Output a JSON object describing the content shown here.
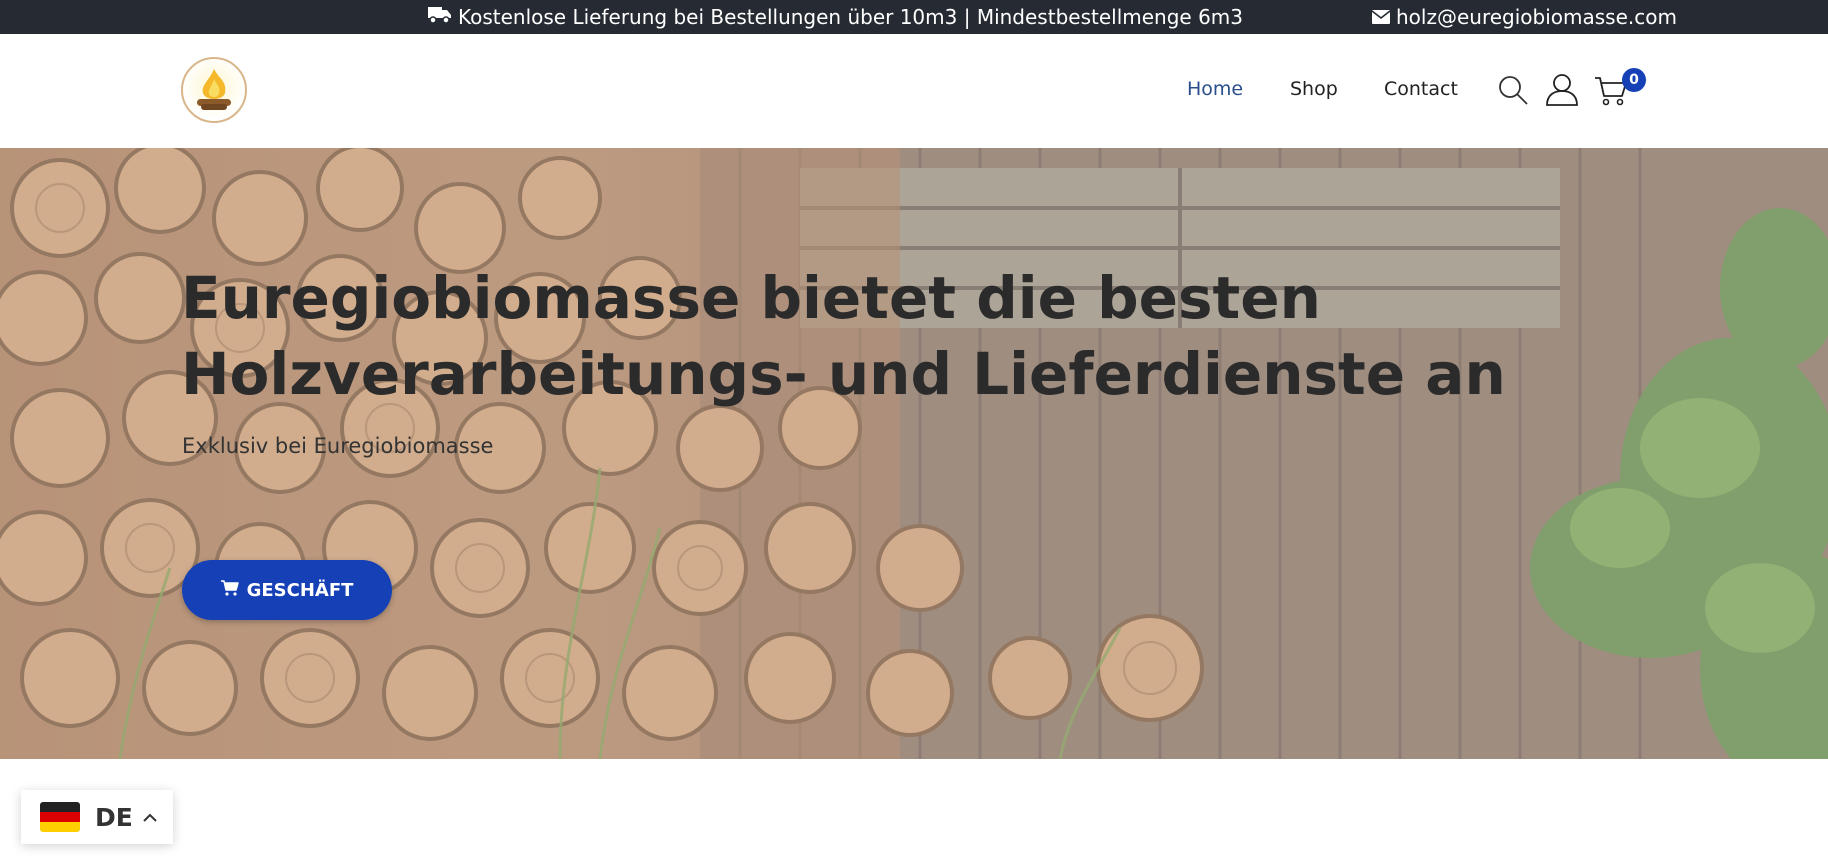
{
  "topbar": {
    "promo_icon": "truck-icon",
    "promo_text": "Kostenlose Lieferung bei Bestellungen über 10m3 | Mindestbestellmenge 6m3",
    "email_icon": "envelope-icon",
    "email": "holz@euregiobiomasse.com",
    "background": "#262b33"
  },
  "header": {
    "logo": "euregiobiomasse-logo",
    "nav": [
      {
        "label": "Home",
        "active": true
      },
      {
        "label": "Shop",
        "active": false
      },
      {
        "label": "Contact",
        "active": false
      }
    ],
    "icons": [
      "search-icon",
      "user-icon",
      "cart-icon"
    ],
    "cart_count": "0",
    "active_color": "#2a4e8c"
  },
  "hero": {
    "title_line1": "Euregiobiomasse bietet die besten",
    "title_line2": "Holzverarbeitungs- und Lieferdienste an",
    "subtitle": "Exklusiv bei Euregiobiomasse",
    "button_label": "GESCHÄFT",
    "button_icon": "cart-icon",
    "button_color": "#1540b6"
  },
  "language": {
    "code": "DE",
    "flag": "germany-flag-icon",
    "chevron": "chevron-up-icon"
  }
}
